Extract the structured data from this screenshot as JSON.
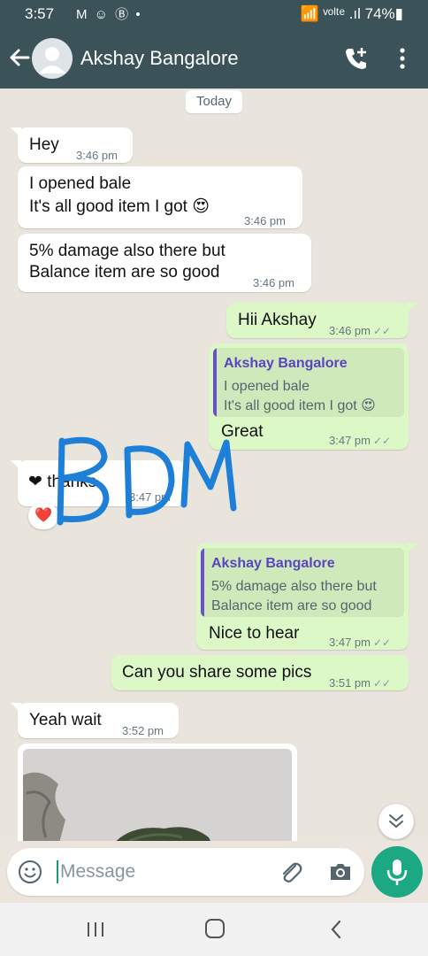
{
  "status_bar": {
    "time": "3:57",
    "left_icons": "M ☺ Ⓑ •",
    "right_text": "📶 ᵛᵒˡᵗᵉ .ıl 74%▮",
    "battery": "74%"
  },
  "header": {
    "contact_name": "Akshay Bangalore",
    "back_icon": "arrow-left",
    "call_add_icon": "phone-plus",
    "menu_icon": "more-vertical"
  },
  "chat": {
    "date_chip": "Today",
    "messages": [
      {
        "dir": "in",
        "lines": [
          "Hey"
        ],
        "time": "3:46 pm"
      },
      {
        "dir": "in",
        "lines": [
          "I opened bale",
          "It's all good item I got 😍"
        ],
        "time": "3:46 pm"
      },
      {
        "dir": "in",
        "lines": [
          "5% damage also there but",
          "Balance item are so good"
        ],
        "time": "3:46 pm"
      },
      {
        "dir": "out",
        "lines": [
          "Hii Akshay"
        ],
        "time": "3:46 pm",
        "ticks": "✓✓"
      },
      {
        "dir": "out",
        "quote": {
          "name": "Akshay Bangalore",
          "lines": [
            "I opened bale",
            "It's all good item I got 😍"
          ]
        },
        "lines": [
          "Great"
        ],
        "time": "3:47 pm",
        "ticks": "✓✓"
      },
      {
        "dir": "in",
        "lines": [
          "❤ thanks"
        ],
        "time": "3:47 pm",
        "reaction": "❤️"
      },
      {
        "dir": "out",
        "quote": {
          "name": "Akshay Bangalore",
          "lines": [
            "5% damage also there but",
            "Balance item are so good"
          ]
        },
        "lines": [
          "Nice to hear"
        ],
        "time": "3:47 pm",
        "ticks": "✓✓"
      },
      {
        "dir": "out",
        "lines": [
          "Can you share some pics"
        ],
        "time": "3:51 pm",
        "ticks": "✓✓"
      },
      {
        "dir": "in",
        "lines": [
          "Yeah wait"
        ],
        "time": "3:52 pm"
      }
    ],
    "watermark_text": "BDM"
  },
  "composer": {
    "placeholder": "Message",
    "emoji_icon": "smiley",
    "attach_icon": "paperclip",
    "camera_icon": "camera",
    "mic_icon": "microphone"
  },
  "colors": {
    "header_bg": "#3a5258",
    "outgoing_bubble": "#dcf8c6",
    "incoming_bubble": "#ffffff",
    "accent": "#1ba883",
    "quote_name": "#5b44c2",
    "watermark": "#1e7fd8"
  }
}
